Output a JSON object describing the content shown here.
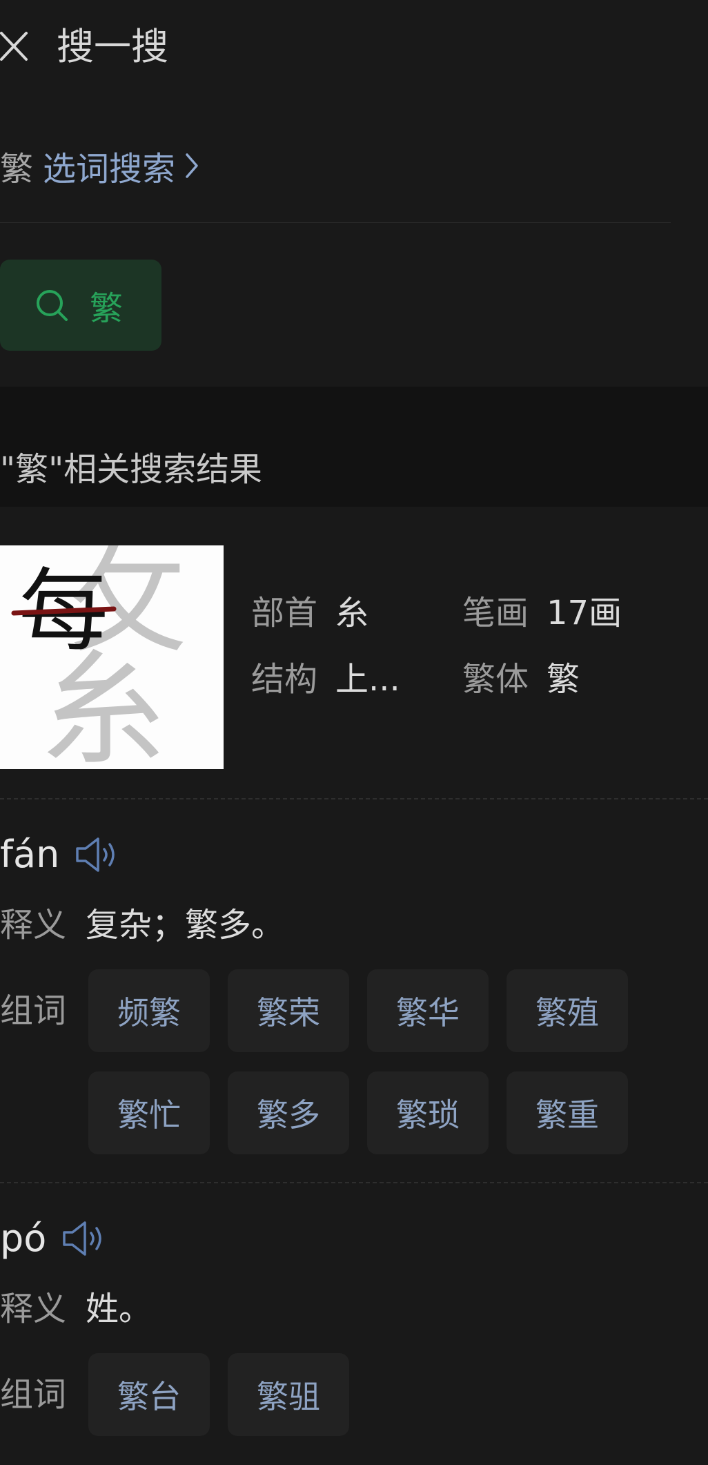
{
  "header": {
    "title": "搜一搜",
    "close_icon": "close-icon"
  },
  "selection": {
    "char": "繁",
    "link_label": "选词搜索"
  },
  "search_chip": {
    "label": "繁",
    "icon": "search-icon",
    "color": "#27a35a"
  },
  "results": {
    "title": "\"繁\"相关搜索结果"
  },
  "char_info": {
    "glyph_top": "每",
    "glyph_right": "攵",
    "glyph_bottom": "糸",
    "attributes": [
      {
        "key": "部首",
        "value": "糸"
      },
      {
        "key": "笔画",
        "value": "17画"
      },
      {
        "key": "结构",
        "value": "上..."
      },
      {
        "key": "繁体",
        "value": "繁"
      }
    ]
  },
  "readings": [
    {
      "pinyin": "fán",
      "def_label": "释义",
      "definition": "复杂；繁多。",
      "words_label": "组词",
      "words": [
        "频繁",
        "繁荣",
        "繁华",
        "繁殖",
        "繁忙",
        "繁多",
        "繁琐",
        "繁重"
      ]
    },
    {
      "pinyin": "pó",
      "def_label": "释义",
      "definition": "姓。",
      "words_label": "组词",
      "words": [
        "繁台",
        "繁驵"
      ]
    }
  ]
}
